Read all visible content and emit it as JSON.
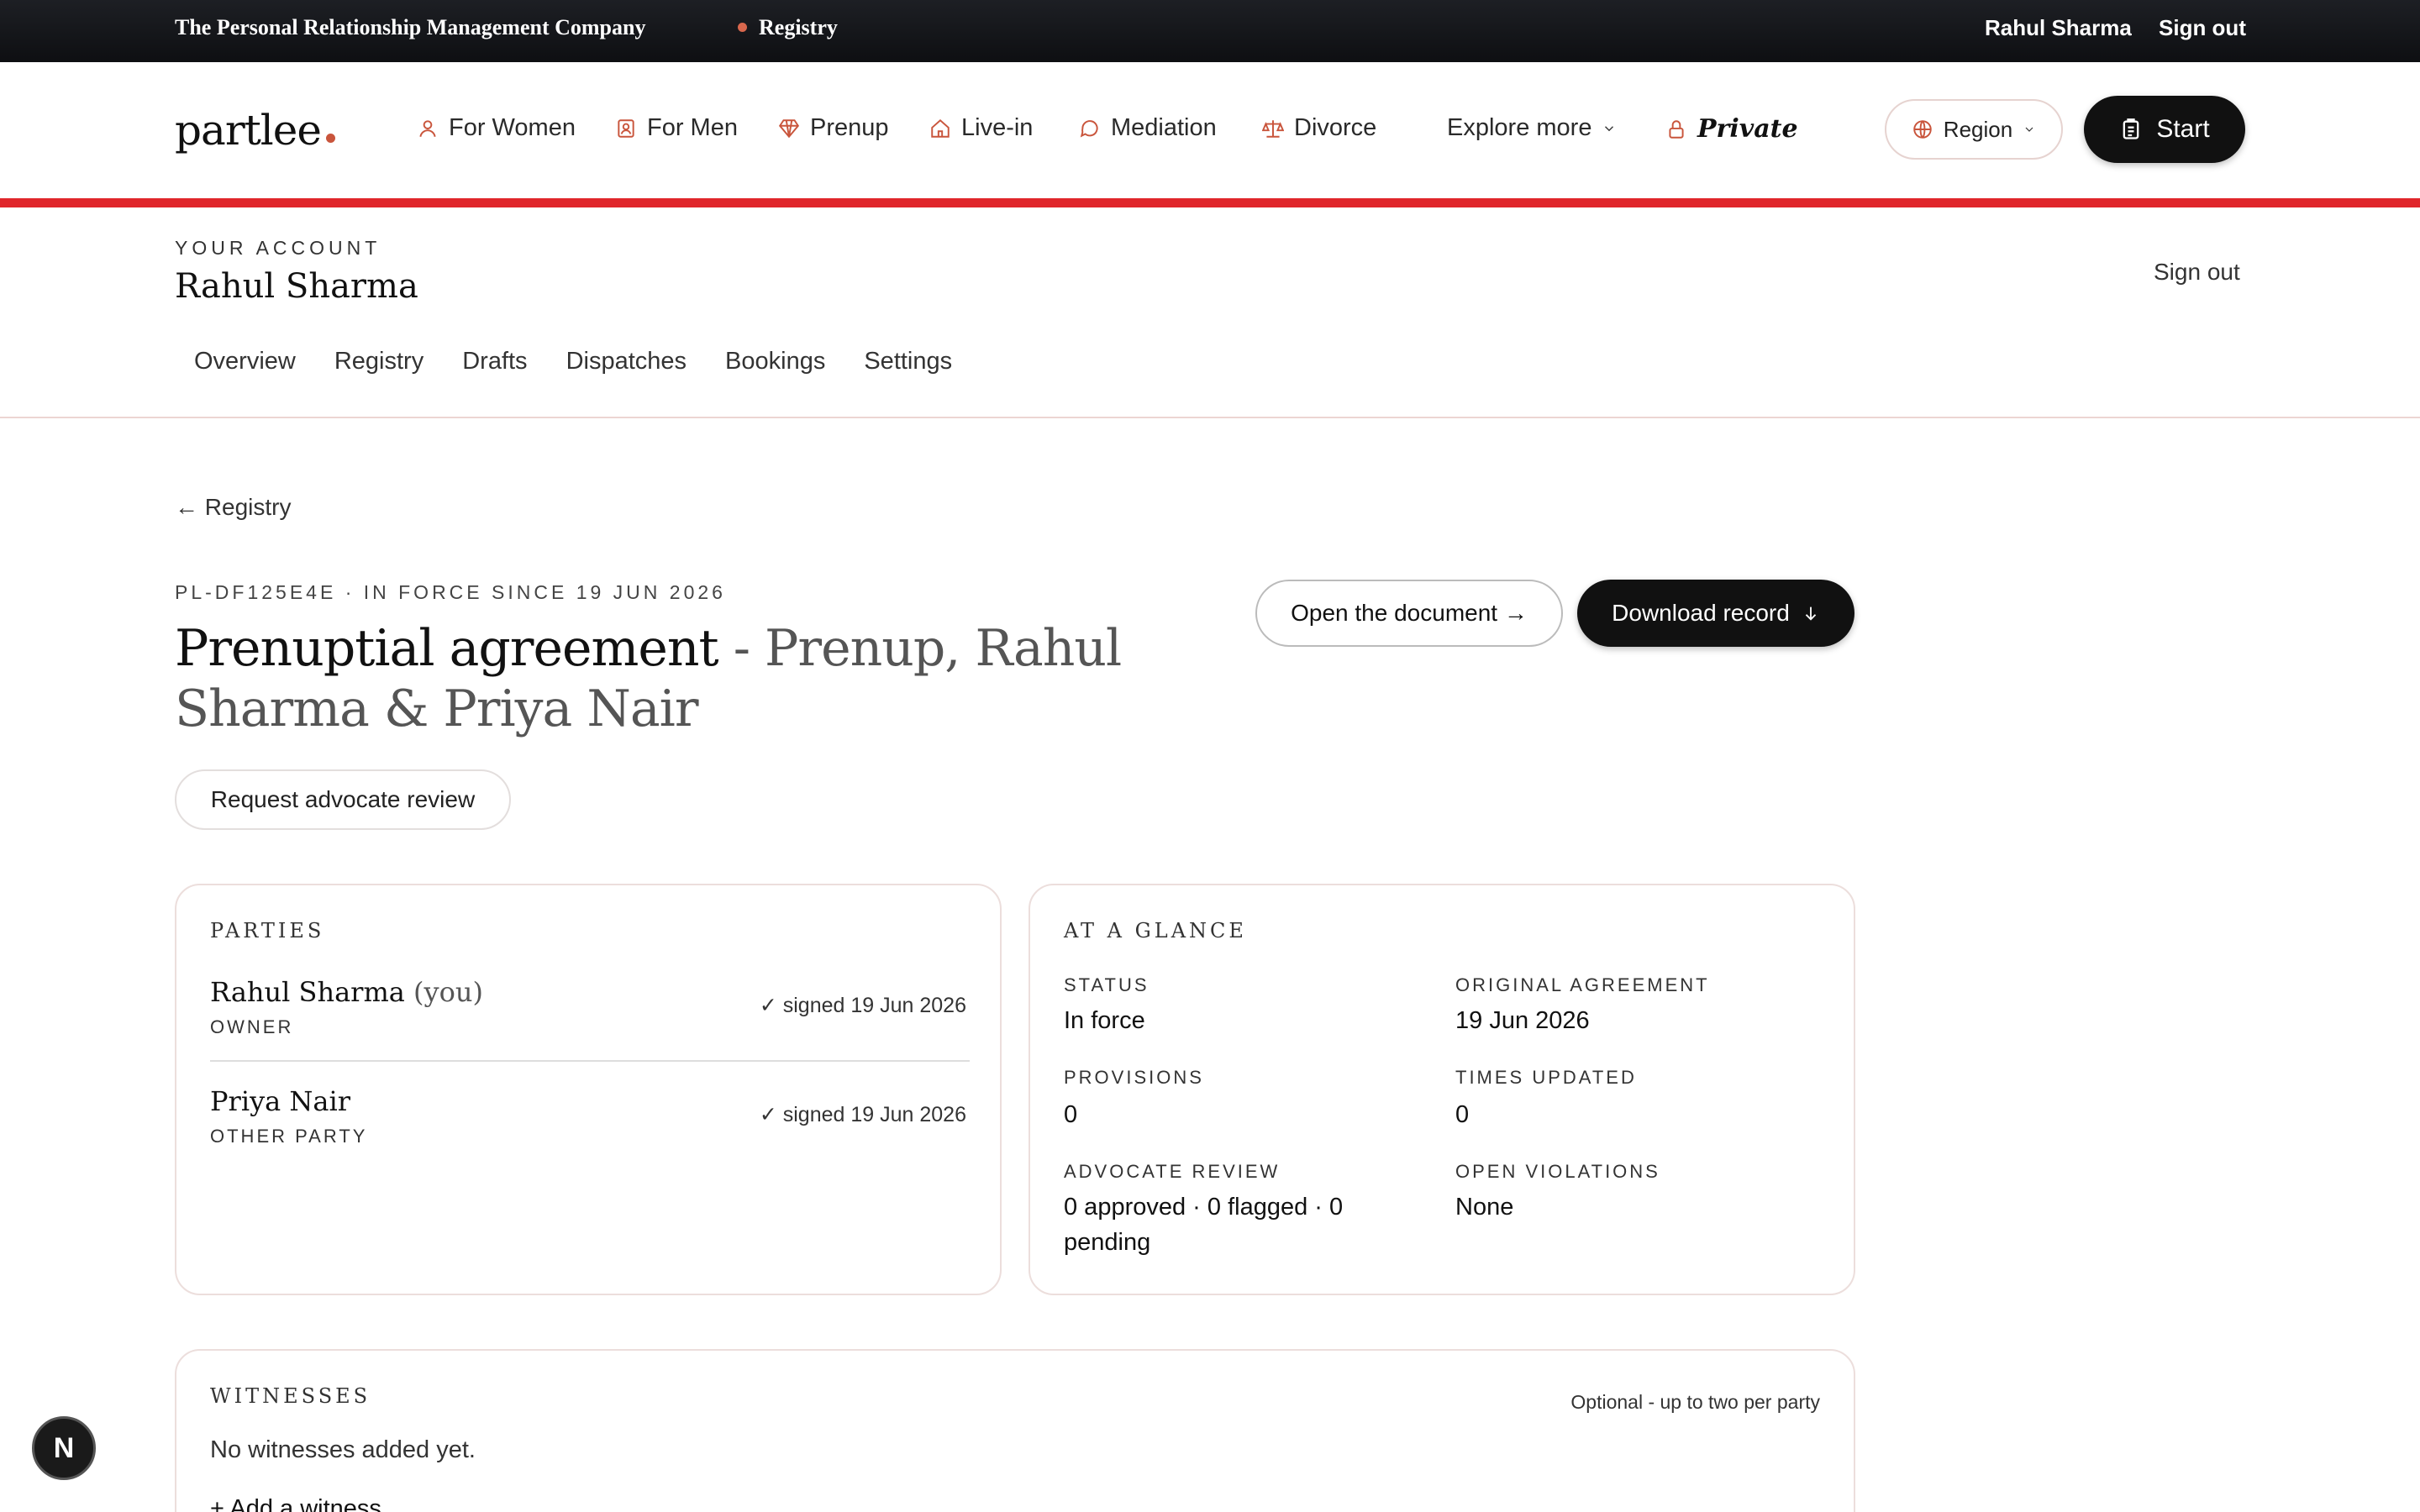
{
  "topbar": {
    "company": "The Personal Relationship Management Company",
    "registry": "Registry",
    "user_name": "Rahul Sharma",
    "sign_out": "Sign out"
  },
  "nav": {
    "logo": "partlee",
    "items": [
      {
        "label": "For Women",
        "icon": "person-icon"
      },
      {
        "label": "For Men",
        "icon": "id-badge-icon"
      },
      {
        "label": "Prenup",
        "icon": "diamond-icon"
      },
      {
        "label": "Live-in",
        "icon": "house-icon"
      },
      {
        "label": "Mediation",
        "icon": "chat-bubble-icon"
      },
      {
        "label": "Divorce",
        "icon": "scales-icon"
      }
    ],
    "explore_more": "Explore more",
    "private": "Private",
    "region": "Region",
    "start": "Start"
  },
  "account": {
    "kicker": "YOUR ACCOUNT",
    "name": "Rahul Sharma",
    "sign_out": "Sign out",
    "tabs": [
      "Overview",
      "Registry",
      "Drafts",
      "Dispatches",
      "Bookings",
      "Settings"
    ]
  },
  "document": {
    "back": "← Registry",
    "meta": "PL-DF125E4E · IN FORCE SINCE 19 JUN 2026",
    "title": "Prenuptial agreement",
    "subtitle": " - Prenup, Rahul Sharma & Priya Nair",
    "open_button": "Open the document →",
    "download_button": "Download record",
    "review_button": "Request advocate review"
  },
  "parties": {
    "kicker": "PARTIES",
    "list": [
      {
        "name": "Rahul Sharma",
        "suffix": " (you)",
        "role": "OWNER",
        "signed": "✓ signed 19 Jun 2026"
      },
      {
        "name": "Priya Nair",
        "suffix": "",
        "role": "OTHER PARTY",
        "signed": "✓ signed 19 Jun 2026"
      }
    ]
  },
  "glance": {
    "kicker": "AT A GLANCE",
    "status_label": "STATUS",
    "status_value": "In force",
    "original_label": "ORIGINAL AGREEMENT",
    "original_value": "19 Jun 2026",
    "provisions_label": "PROVISIONS",
    "provisions_value": "0",
    "times_updated_label": "TIMES UPDATED",
    "times_updated_value": "0",
    "advocate_label": "ADVOCATE REVIEW",
    "advocate_value": "0 approved · 0 flagged · 0 pending",
    "violations_label": "OPEN VIOLATIONS",
    "violations_value": "None"
  },
  "witnesses": {
    "kicker": "WITNESSES",
    "note": "Optional - up to two per party",
    "empty": "No witnesses added yet.",
    "add": "+ Add a witness"
  },
  "badge": "N",
  "colors": {
    "accent": "#c9553c",
    "rule_red": "#e0262b",
    "dark": "#111111"
  }
}
